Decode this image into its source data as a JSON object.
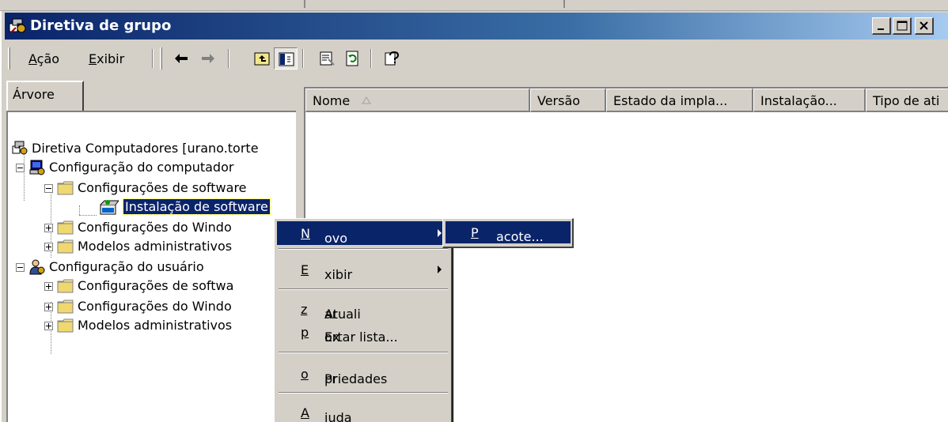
{
  "window": {
    "title": "Diretiva de grupo",
    "icon": "group-policy-icon",
    "controls": [
      "minimize-icon",
      "maximize-icon",
      "close-icon"
    ]
  },
  "menubar": {
    "acao": {
      "pre": "",
      "key": "A",
      "post": "ção"
    },
    "exibir": {
      "pre": "",
      "key": "E",
      "post": "xibir"
    }
  },
  "toolbar_icons": [
    "back-arrow-icon",
    "forward-arrow-icon",
    "up-one-level-icon",
    "show-hide-tree-icon",
    "properties-icon",
    "refresh-icon",
    "help-icon"
  ],
  "tree_tab": {
    "label": "Árvore"
  },
  "tree": {
    "root": "Diretiva Computadores [urano.torte",
    "computer_config": "Configuração do computador",
    "software_settings": "Configurações de software",
    "software_install": "Instalação de software",
    "windows_settings": "Configurações do Windo",
    "admin_templates": "Modelos administrativos",
    "user_config": "Configuração do usuário",
    "user_software_settings": "Configurações de softwa",
    "user_windows_settings": "Configurações do Windo",
    "user_admin_templates": "Modelos administrativos"
  },
  "list": {
    "columns": [
      "Nome",
      "Versão",
      "Estado da impla...",
      "Instalação...",
      "Tipo de ati"
    ],
    "sort_indicator": "sort-ascending-icon"
  },
  "context_menu": {
    "novo": {
      "pre": "",
      "key": "N",
      "post": "ovo"
    },
    "exibir": {
      "pre": "",
      "key": "E",
      "post": "xibir"
    },
    "atualizar": {
      "pre": "Atuali",
      "key": "z",
      "post": "ar"
    },
    "exportar": {
      "pre": "Ex",
      "key": "p",
      "post": "ortar lista..."
    },
    "propriedades": {
      "pre": "Pr",
      "key": "o",
      "post": "priedades"
    },
    "ajuda": {
      "pre": "",
      "key": "A",
      "post": "juda"
    }
  },
  "submenu": {
    "pacote": {
      "pre": "",
      "key": "P",
      "post": "acote..."
    }
  },
  "colors": {
    "title_start": "#0a246a",
    "title_end": "#a6caf0",
    "face": "#d4d0c8",
    "highlight": "#0a246a"
  }
}
